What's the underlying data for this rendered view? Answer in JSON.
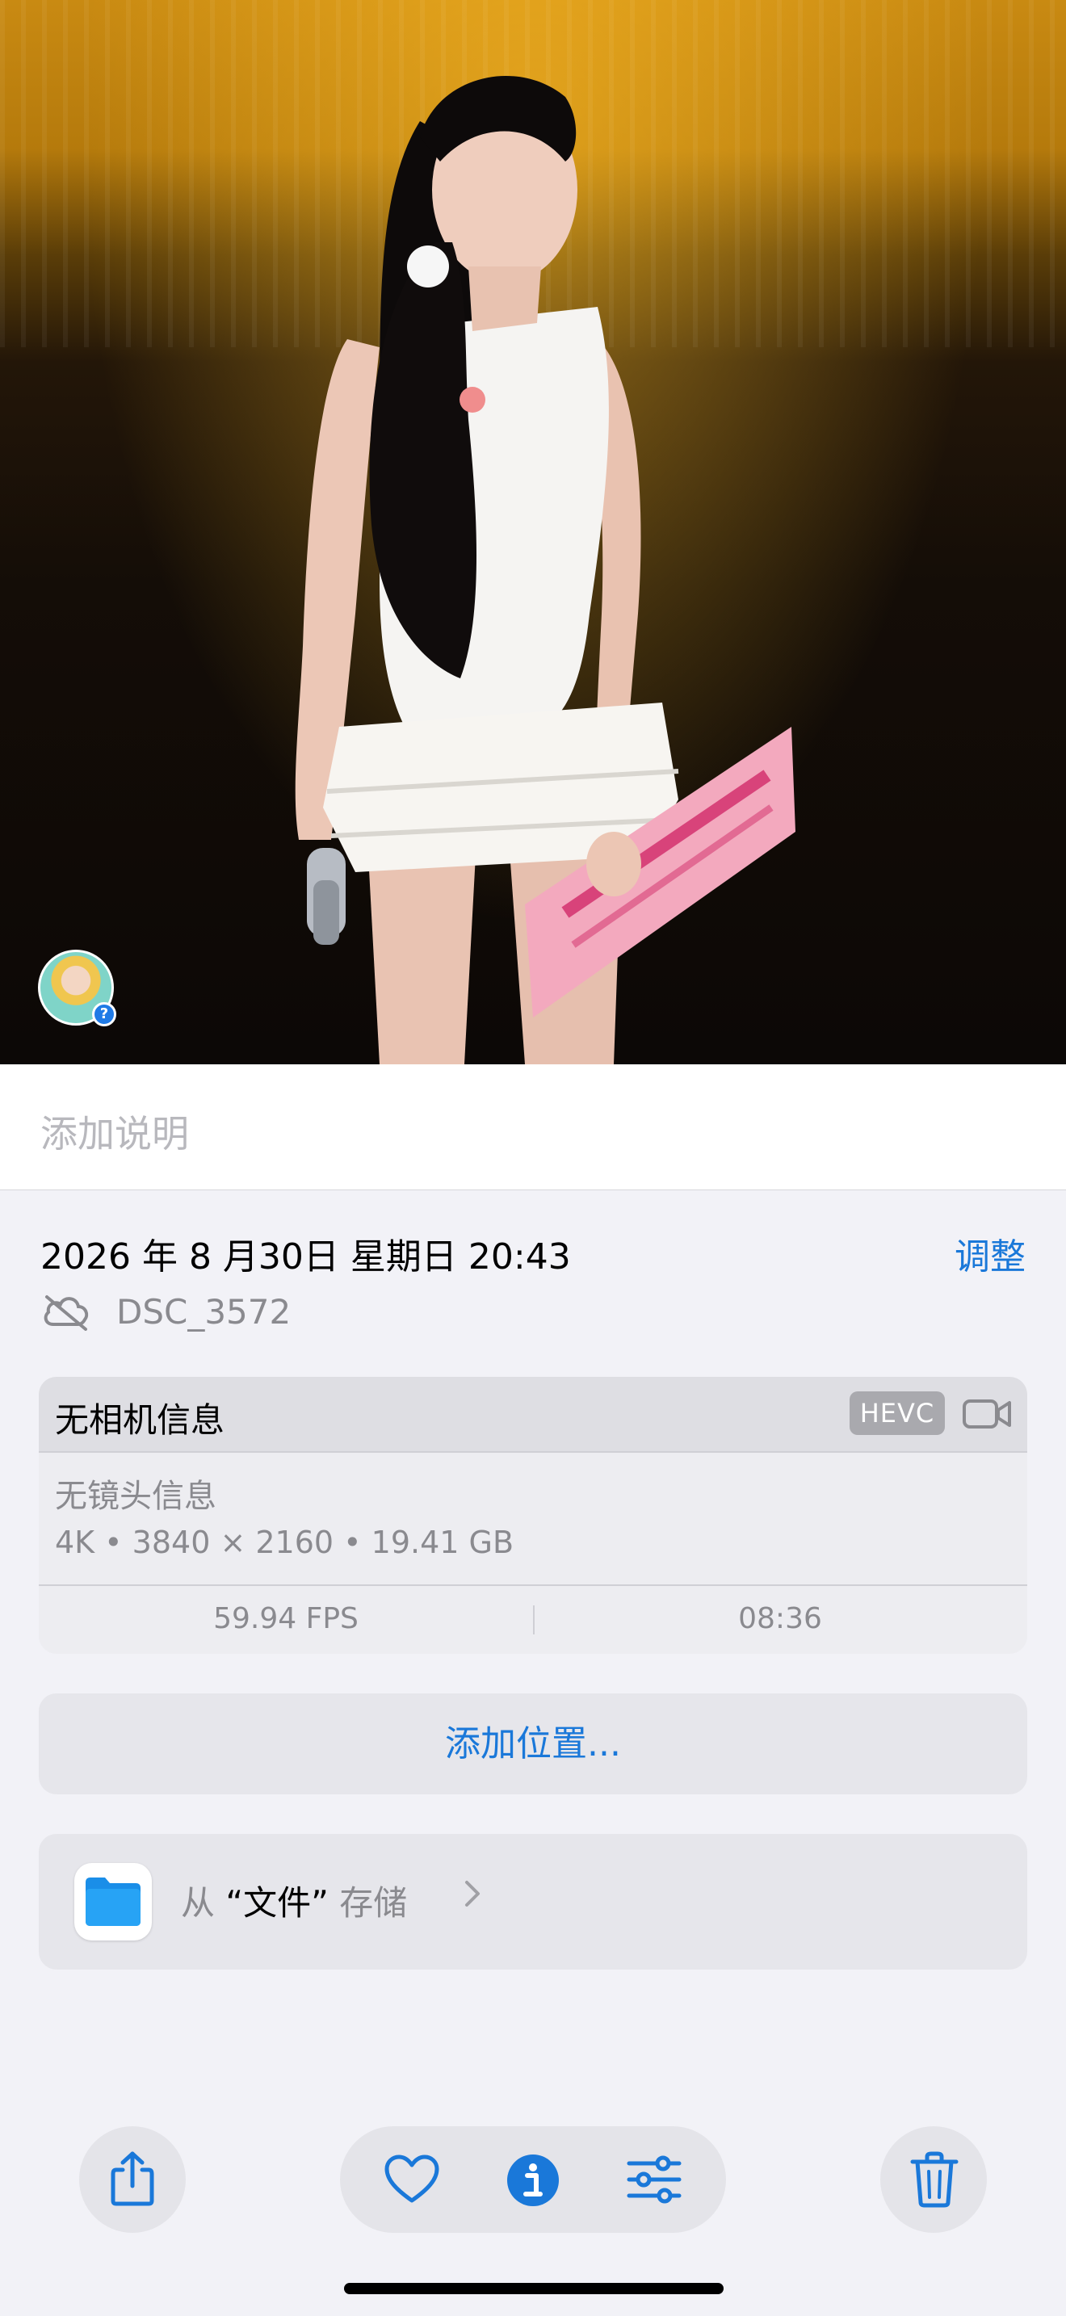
{
  "caption": {
    "placeholder": "添加说明"
  },
  "info": {
    "datetime": "2026 年 8 月30日 星期日 20:43",
    "adjust_label": "调整",
    "filename": "DSC_3572"
  },
  "camera": {
    "title": "无相机信息",
    "codec_badge": "HEVC",
    "lens": "无镜头信息",
    "specs": "4K • 3840 × 2160 • 19.41 GB",
    "fps": "59.94 FPS",
    "duration": "08:36"
  },
  "location": {
    "label": "添加位置..."
  },
  "files": {
    "prefix": "从",
    "app_name": "“文件”",
    "suffix": "存储"
  },
  "toolbar": {
    "icons": [
      "share-icon",
      "heart-icon",
      "info-icon",
      "adjust-sliders-icon",
      "trash-icon"
    ],
    "active_color": "#1a78d9"
  },
  "colors": {
    "accent": "#1a78d9"
  }
}
